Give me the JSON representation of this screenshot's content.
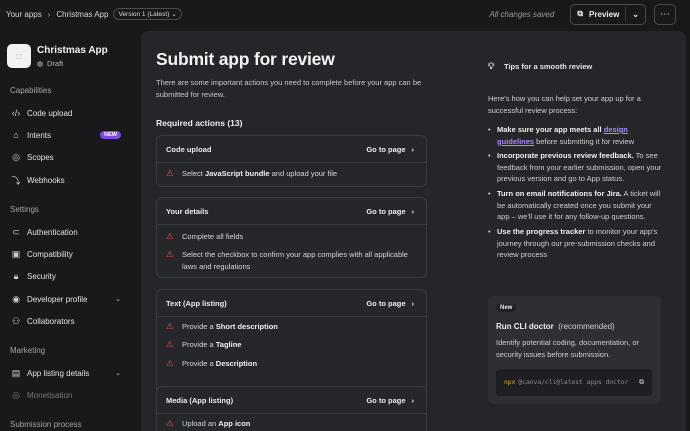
{
  "topbar": {
    "crumb_apps": "Your apps",
    "crumb_app": "Christmas App",
    "version": "Version 1 (Latest)",
    "saved_status": "All changes saved",
    "preview_label": "Preview"
  },
  "sidebar": {
    "app_name": "Christmas App",
    "app_status": "Draft",
    "sections": {
      "capabilities": "Capabilities",
      "settings": "Settings",
      "marketing": "Marketing",
      "submission": "Submission process"
    },
    "items": {
      "code_upload": "Code upload",
      "intents": "Intents",
      "intents_badge": "NEW",
      "scopes": "Scopes",
      "webhooks": "Webhooks",
      "authentication": "Authentication",
      "compatibility": "Compatibility",
      "security": "Security",
      "developer_profile": "Developer profile",
      "collaborators": "Collaborators",
      "app_listing_details": "App listing details",
      "monetisation": "Monetisation"
    }
  },
  "main": {
    "title": "Submit app for review",
    "intro": "There are some important actions you need to complete before your app can be submitted for review.",
    "required_heading": "Required actions (13)",
    "goto_label": "Go to page",
    "cards": [
      {
        "title": "Code upload",
        "tasks": [
          {
            "pre": "Select ",
            "bold": "JavaScript bundle",
            "post": " and upload your file"
          }
        ]
      },
      {
        "title": "Your details",
        "tasks": [
          {
            "pre": "Complete all fields",
            "bold": "",
            "post": ""
          },
          {
            "pre": "Select the checkbox to confirm your app complies with all applicable laws and regulations",
            "bold": "",
            "post": ""
          }
        ]
      },
      {
        "title": "Text (App listing)",
        "tasks": [
          {
            "pre": "Provide a ",
            "bold": "Short description",
            "post": ""
          },
          {
            "pre": "Provide a ",
            "bold": "Tagline",
            "post": ""
          },
          {
            "pre": "Provide a ",
            "bold": "Description",
            "post": ""
          }
        ]
      },
      {
        "title": "Media (App listing)",
        "tasks": [
          {
            "pre": "Upload an ",
            "bold": "App icon",
            "post": ""
          }
        ]
      }
    ]
  },
  "tips": {
    "heading": "Tips for a smooth review",
    "intro": "Here's how you can help set your app up for a successful review process:",
    "items": [
      {
        "bold": "Make sure your app meets all ",
        "link": "design guidelines",
        "rest": " before submitting it for review"
      },
      {
        "bold": "Incorporate previous review feedback.",
        "link": "",
        "rest": " To see feedback from your earlier submission, open your previous version and go to App status."
      },
      {
        "bold": "Turn on email notifications for Jira.",
        "link": "",
        "rest": " A ticket will be automatically created once you submit your app – we'll use it for any follow-up questions."
      },
      {
        "bold": "Use the progress tracker",
        "link": "",
        "rest": " to monitor your app's journey through our pre-submission checks and review process"
      }
    ],
    "cli": {
      "badge": "New",
      "title": "Run CLI doctor",
      "subtitle": "(recommended)",
      "description": "Identify potential coding, documentation, or security issues before submission.",
      "code_npx": "npx",
      "code_rest": "@canva/cli@latest apps doctor"
    }
  },
  "icons": {
    "warning": "warning-triangle-icon",
    "copy": "copy-icon",
    "bulb": "lightbulb-icon"
  },
  "colors": {
    "accent_purple": "#7d4be0",
    "warning_red": "#e2505a",
    "code_orange": "#e0a33a"
  }
}
